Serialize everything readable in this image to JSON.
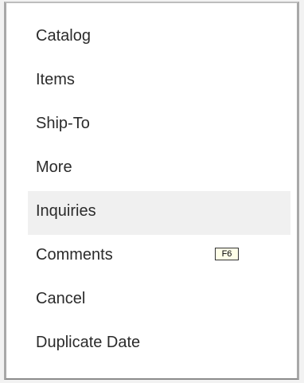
{
  "menu": {
    "items": [
      {
        "label": "Catalog"
      },
      {
        "label": "Items"
      },
      {
        "label": "Ship-To"
      },
      {
        "label": "More"
      },
      {
        "label": "Inquiries",
        "highlighted": true
      },
      {
        "label": "Comments",
        "shortcut": "F6"
      },
      {
        "label": "Cancel"
      },
      {
        "label": "Duplicate Date"
      }
    ]
  },
  "colors": {
    "highlight": "#f0f0f0",
    "shortcut_background": "#ffffe8",
    "text": "#2b2b2b"
  }
}
